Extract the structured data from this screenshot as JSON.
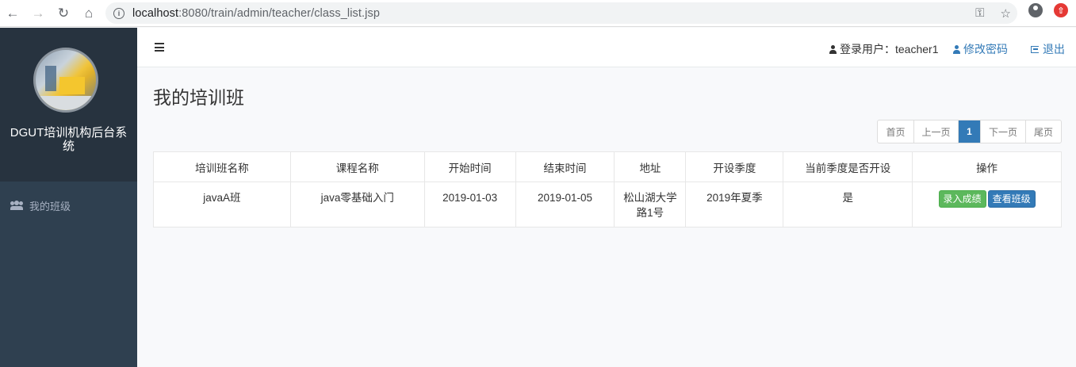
{
  "browser": {
    "url_host": "localhost",
    "url_path": ":8080/train/admin/teacher/class_list.jsp"
  },
  "sidebar": {
    "brand_name": "DGUT培训机构后台系统",
    "items": [
      {
        "label": "我的班级",
        "icon": "users-icon"
      }
    ]
  },
  "topbar": {
    "user_label": "登录用户：teacher1",
    "change_password": "修改密码",
    "logout": "退出"
  },
  "main": {
    "title": "我的培训班",
    "pagination": {
      "first": "首页",
      "prev": "上一页",
      "current": "1",
      "next": "下一页",
      "last": "尾页"
    },
    "table": {
      "headers": [
        "培训班名称",
        "课程名称",
        "开始时间",
        "结束时间",
        "地址",
        "开设季度",
        "当前季度是否开设",
        "操作"
      ],
      "rows": [
        {
          "name": "javaA班",
          "course": "java零基础入门",
          "start": "2019-01-03",
          "end": "2019-01-05",
          "address": "松山湖大学路1号",
          "season": "2019年夏季",
          "current": "是",
          "action_grade": "录入成绩",
          "action_view": "查看班级"
        }
      ]
    }
  },
  "colors": {
    "sidebar_bg": "#2f4050",
    "brand_bg": "#27333f",
    "accent": "#337ab7",
    "success": "#5cb85c"
  }
}
